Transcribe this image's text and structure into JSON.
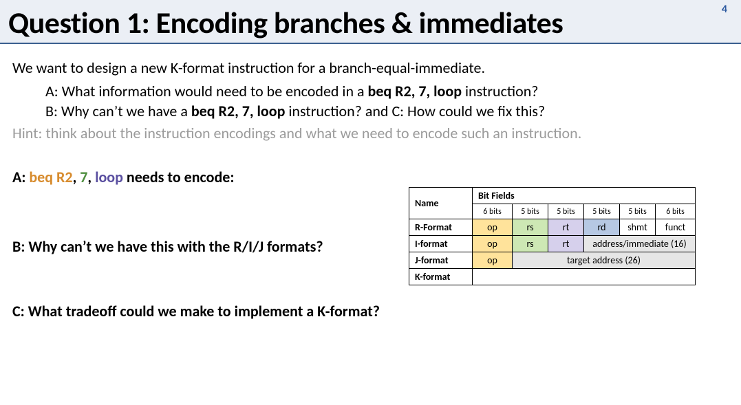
{
  "page_number": "4",
  "title": "Question 1: Encoding branches & immediates",
  "intro": "We want to design a new K-format instruction for a branch-equal-immediate.",
  "subA_prefix": "A: What information would need to be encoded in a ",
  "subA_code": "beq R2, 7, loop",
  "subA_suffix": " instruction?",
  "subB_prefix": "B: Why can’t we have a ",
  "subB_code": "beq R2, 7, loop",
  "subB_suffix": " instruction? and C: How could we fix this?",
  "hint": "Hint: think about the instruction encodings and what we need to encode such an instruction.",
  "qa": {
    "label": "A: ",
    "beq": "beq ",
    "r2": "R2",
    "c1": ", ",
    "seven": "7",
    "c2": ", ",
    "loop": "loop",
    "rest": " needs to encode:"
  },
  "qb": "B: Why can’t we have this with the R/I/J formats?",
  "qc": "C: What tradeoff could we make to implement a K-format?",
  "table": {
    "name_hdr": "Name",
    "bits_hdr": "Bit Fields",
    "bits": [
      "6 bits",
      "5 bits",
      "5 bits",
      "5 bits",
      "5 bits",
      "6 bits"
    ],
    "r_name": "R-Format",
    "r": [
      "op",
      "rs",
      "rt",
      "rd",
      "shmt",
      "funct"
    ],
    "i_name": "I-format",
    "i_op": "op",
    "i_rs": "rs",
    "i_rt": "rt",
    "i_addr": "address/immediate (16)",
    "j_name": "J-format",
    "j_op": "op",
    "j_target": "target address (26)",
    "k_name": "K-format"
  }
}
